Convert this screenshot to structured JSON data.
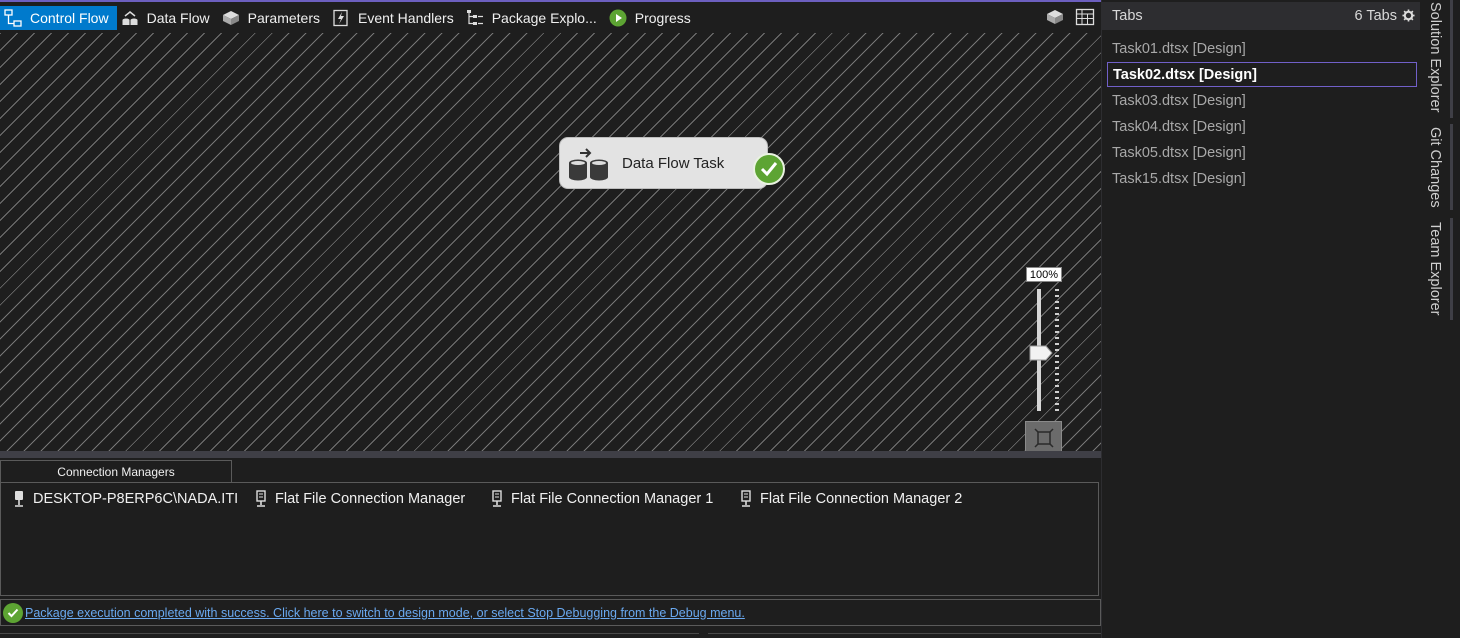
{
  "designer": {
    "tabs": [
      {
        "label": "Control Flow",
        "icon": "control-flow-icon",
        "active": true
      },
      {
        "label": "Data Flow",
        "icon": "data-flow-icon",
        "active": false
      },
      {
        "label": "Parameters",
        "icon": "parameters-icon",
        "active": false
      },
      {
        "label": "Event Handlers",
        "icon": "event-handlers-icon",
        "active": false
      },
      {
        "label": "Package Explo...",
        "icon": "package-explorer-icon",
        "active": false
      },
      {
        "label": "Progress",
        "icon": "progress-icon",
        "active": false
      }
    ],
    "right_icons": [
      "package-parts-icon",
      "variables-grid-icon"
    ]
  },
  "canvas": {
    "task": {
      "label": "Data Flow Task",
      "status": "success",
      "icon": "data-flow-task-icon"
    },
    "zoom": {
      "label": "100%",
      "level_percent": 100
    }
  },
  "connection_managers": {
    "tab_label": "Connection Managers",
    "items": [
      {
        "label": "DESKTOP-P8ERP6C\\NADA.ITI",
        "icon": "ole-db-connection-icon"
      },
      {
        "label": "Flat File Connection Manager",
        "icon": "flat-file-connection-icon"
      },
      {
        "label": "Flat File Connection Manager 1",
        "icon": "flat-file-connection-icon"
      },
      {
        "label": "Flat File Connection Manager 2",
        "icon": "flat-file-connection-icon"
      }
    ]
  },
  "status_bar": {
    "message": "Package execution completed with success. Click here to switch to design mode, or select Stop Debugging from the Debug menu."
  },
  "tabs_panel": {
    "title": "Tabs",
    "count": "6 Tabs",
    "files": [
      {
        "label": "Task01.dtsx [Design]",
        "selected": false
      },
      {
        "label": "Task02.dtsx [Design]",
        "selected": true
      },
      {
        "label": "Task03.dtsx [Design]",
        "selected": false
      },
      {
        "label": "Task04.dtsx [Design]",
        "selected": false
      },
      {
        "label": "Task05.dtsx [Design]",
        "selected": false
      },
      {
        "label": "Task15.dtsx [Design]",
        "selected": false
      }
    ]
  },
  "side_tabs": [
    "Solution Explorer",
    "Git Changes",
    "Team Explorer"
  ],
  "colors": {
    "accent": "#007acc",
    "success": "#5da433",
    "selection_border": "#7160c9",
    "link": "#6aa9f0"
  }
}
